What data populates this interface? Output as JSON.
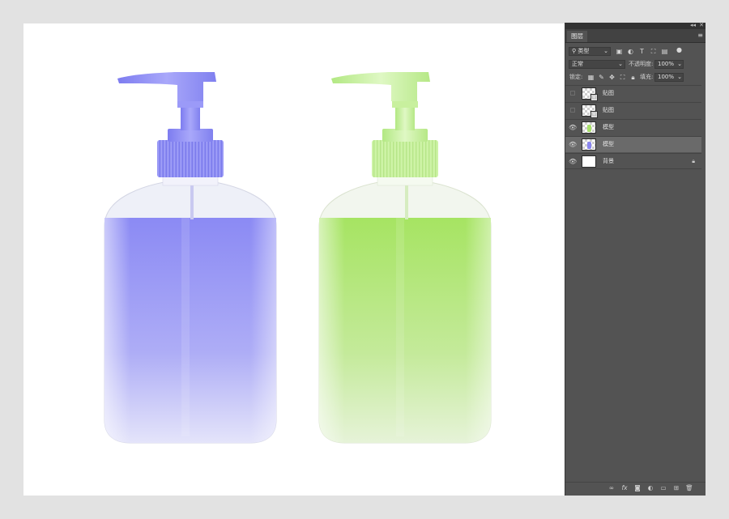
{
  "layers_panel": {
    "tab_label": "图层",
    "top_controls": [
      "◂◂",
      "✕"
    ],
    "filter": {
      "icon": "search-icon",
      "value": "类型"
    },
    "blend_mode": "正常",
    "opacity_label": "不透明度:",
    "opacity_value": "100%",
    "lock_label": "锁定:",
    "fill_label": "填充:",
    "fill_value": "100%",
    "layers": [
      {
        "name": "贴图",
        "visible": false,
        "thumb": "checker",
        "smart_object": true
      },
      {
        "name": "贴图",
        "visible": false,
        "thumb": "checker",
        "smart_object": true
      },
      {
        "name": "模型",
        "visible": true,
        "thumb": "checker",
        "blob_color": "#a8e06a"
      },
      {
        "name": "模型",
        "visible": true,
        "thumb": "checker",
        "selected": true,
        "blob_color": "#8a86f0"
      },
      {
        "name": "背景",
        "visible": true,
        "thumb": "white",
        "locked": true
      }
    ]
  },
  "canvas": {
    "background": "#ffffff",
    "bottles": [
      {
        "label": "purple-soap-bottle",
        "pump": "#8f8ff6",
        "liquid": "#8d8cf5"
      },
      {
        "label": "green-soap-bottle",
        "pump": "#c2f095",
        "liquid": "#a9e468"
      }
    ]
  }
}
